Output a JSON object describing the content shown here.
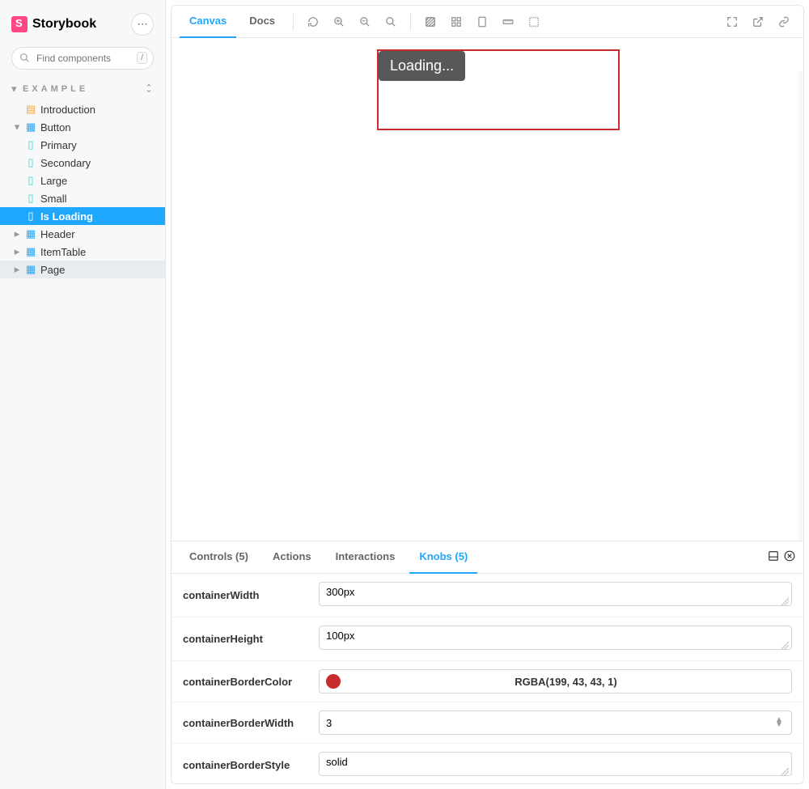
{
  "app": {
    "name": "Storybook"
  },
  "sidebar": {
    "search_placeholder": "Find components",
    "search_kbd": "/",
    "group_label": "EXAMPLE",
    "items": [
      {
        "label": "Introduction"
      },
      {
        "label": "Button"
      },
      {
        "label": "Primary"
      },
      {
        "label": "Secondary"
      },
      {
        "label": "Large"
      },
      {
        "label": "Small"
      },
      {
        "label": "Is Loading"
      },
      {
        "label": "Header"
      },
      {
        "label": "ItemTable"
      },
      {
        "label": "Page"
      }
    ]
  },
  "toolbar": {
    "tabs": {
      "canvas": "Canvas",
      "docs": "Docs"
    }
  },
  "preview": {
    "loading_text": "Loading...",
    "border_color": "#c72b2b"
  },
  "addons": {
    "tabs": {
      "controls": "Controls (5)",
      "actions": "Actions",
      "interactions": "Interactions",
      "knobs": "Knobs (5)"
    },
    "knobs": [
      {
        "name": "containerWidth",
        "value": "300px",
        "type": "text"
      },
      {
        "name": "containerHeight",
        "value": "100px",
        "type": "text"
      },
      {
        "name": "containerBorderColor",
        "value": "RGBA(199, 43, 43, 1)",
        "color": "#c72b2b",
        "type": "color"
      },
      {
        "name": "containerBorderWidth",
        "value": "3",
        "type": "number"
      },
      {
        "name": "containerBorderStyle",
        "value": "solid",
        "type": "text"
      }
    ]
  }
}
